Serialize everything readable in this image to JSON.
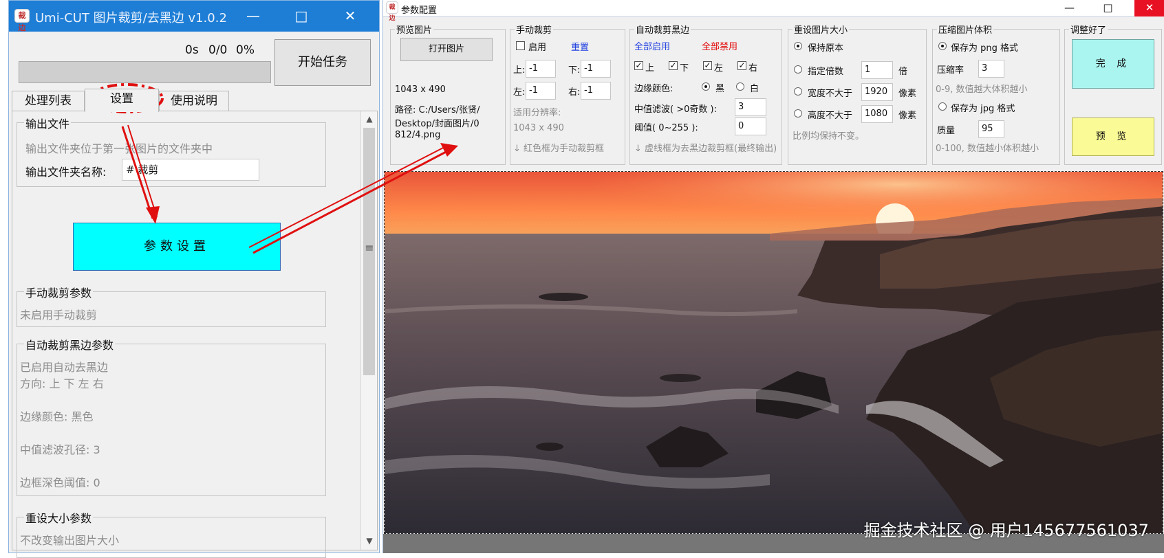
{
  "left_window": {
    "title": "Umi-CUT 图片裁剪/去黑边 v1.0.2",
    "icon_text": "裁边",
    "progress": {
      "time": "0s",
      "count": "0/0",
      "percent": "0%",
      "fraction": 0
    },
    "start_button": "开始任务",
    "tabs": [
      "处理列表",
      "设置",
      "使用说明"
    ],
    "active_tab_index": 1,
    "output_group": {
      "caption": "输出文件",
      "note": "输出文件夹位于第一张图片的文件夹中",
      "folder_label": "输出文件夹名称:",
      "folder_value": "# 裁剪"
    },
    "param_button": "参数设置",
    "manual_group": {
      "caption": "手动裁剪参数",
      "lines": [
        "未启用手动裁剪"
      ]
    },
    "auto_group": {
      "caption": "自动裁剪黑边参数",
      "lines": [
        "已启用自动去黑边",
        "方向: 上 下 左 右",
        "边缘颜色: 黑色",
        "中值滤波孔径: 3",
        "边框深色阈值: 0"
      ]
    },
    "resize_group": {
      "caption": "重设大小参数",
      "lines": [
        "不改变输出图片大小"
      ]
    }
  },
  "right_window": {
    "title": "参数配置",
    "icon_text": "裁边",
    "preview_group": {
      "caption": "预览图片",
      "open_button": "打开图片",
      "size": "1043 x 490",
      "path": [
        "路径: C:/Users/张贤/",
        "Desktop/封面图片/0",
        "812/4.png"
      ]
    },
    "manual_group": {
      "caption": "手动裁剪",
      "enable_label": "启用",
      "enabled": false,
      "reset_link": "重置",
      "top_label": "上:",
      "top": "-1",
      "bottom_label": "下:",
      "bottom": "-1",
      "left_label": "左:",
      "left": "-1",
      "right_label": "右:",
      "right": "-1",
      "resolution_label": "适用分辨率:",
      "resolution": "1043 x 490",
      "hint": "↓ 红色框为手动裁剪框"
    },
    "auto_group": {
      "caption": "自动裁剪黑边",
      "all_on": "全部启用",
      "all_off": "全部禁用",
      "directions": [
        {
          "label": "上",
          "checked": true
        },
        {
          "label": "下",
          "checked": true
        },
        {
          "label": "左",
          "checked": true
        },
        {
          "label": "右",
          "checked": true
        }
      ],
      "edge_label": "边缘颜色:",
      "edge_black": "黑",
      "edge_white": "白",
      "edge_selected": "黑",
      "median_label": "中值滤波( >0奇数 ):",
      "median": "3",
      "threshold_label": "阈值( 0~255 ):",
      "threshold": "0",
      "hint": "↓ 虚线框为去黑边裁剪框(最终输出)"
    },
    "resize_group": {
      "caption": "重设图片大小",
      "keep": "保持原本",
      "scale_label": "指定倍数",
      "scale": "1",
      "scale_unit": "倍",
      "width_label": "宽度不大于",
      "width": "1920",
      "width_unit": "像素",
      "height_label": "高度不大于",
      "height": "1080",
      "height_unit": "像素",
      "note": "比例均保持不变。",
      "selected": "保持原本"
    },
    "compress_group": {
      "caption": "压缩图片体积",
      "png_label": "保存为 png 格式",
      "rate_label": "压缩率",
      "rate": "3",
      "rate_note": "0-9, 数值越大体积越小",
      "jpg_label": "保存为 jpg 格式",
      "quality_label": "质量",
      "quality": "95",
      "quality_note": "0-100, 数值越小体积越小",
      "selected": "png"
    },
    "finish_group": {
      "caption": "调整好了",
      "done": "完 成",
      "preview": "预 览"
    }
  },
  "watermark": "掘金技术社区 @ 用户145677561037",
  "colors": {
    "title_blue": "#1e7ed6",
    "cyan_button": "#00ffff",
    "done_button": "#aaf5f0",
    "preview_button": "#fafa96",
    "annotation_red": "#e01010"
  }
}
